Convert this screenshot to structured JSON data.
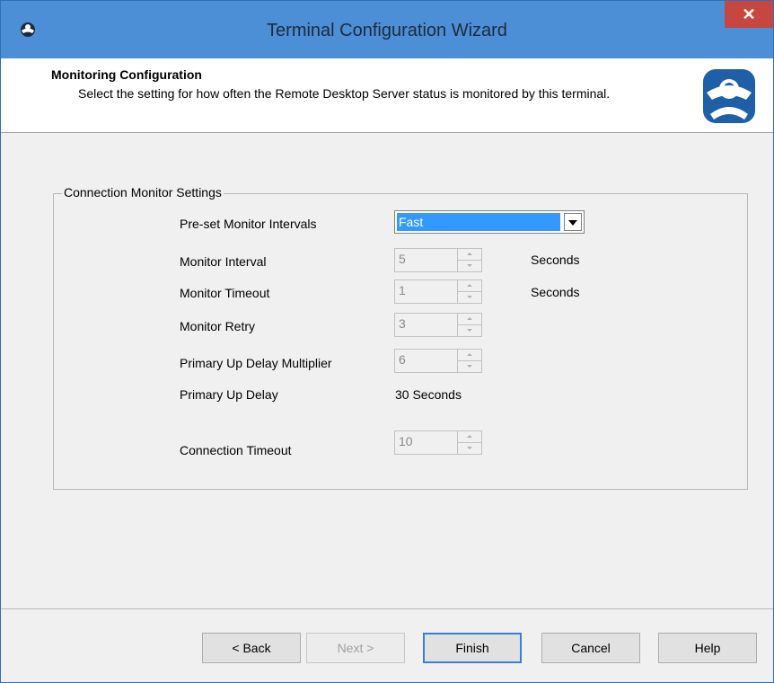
{
  "window": {
    "title": "Terminal Configuration Wizard",
    "close_label": "✕"
  },
  "header": {
    "title": "Monitoring Configuration",
    "description": "Select the setting for how often the Remote Desktop Server status is monitored by this terminal."
  },
  "group": {
    "legend": "Connection Monitor Settings",
    "preset": {
      "label": "Pre-set Monitor Intervals",
      "value": "Fast"
    },
    "monitor_interval": {
      "label": "Monitor Interval",
      "value": "5",
      "unit": "Seconds"
    },
    "monitor_timeout": {
      "label": "Monitor Timeout",
      "value": "1",
      "unit": "Seconds"
    },
    "monitor_retry": {
      "label": "Monitor Retry",
      "value": "3"
    },
    "primary_up_delay_multiplier": {
      "label": "Primary Up Delay Multiplier",
      "value": "6"
    },
    "primary_up_delay": {
      "label": "Primary Up Delay",
      "value": "30 Seconds"
    },
    "connection_timeout": {
      "label": "Connection Timeout",
      "value": "10"
    }
  },
  "buttons": {
    "back": "< Back",
    "next": "Next >",
    "finish": "Finish",
    "cancel": "Cancel",
    "help": "Help"
  },
  "colors": {
    "titlebar": "#4d8fd6",
    "close": "#c7463f",
    "selection": "#3399ff",
    "logo": "#1f5fa8"
  },
  "icons": {
    "app": "terminal-icon",
    "logo": "thinmanager-logo-icon",
    "dropdown": "chevron-down-icon"
  }
}
